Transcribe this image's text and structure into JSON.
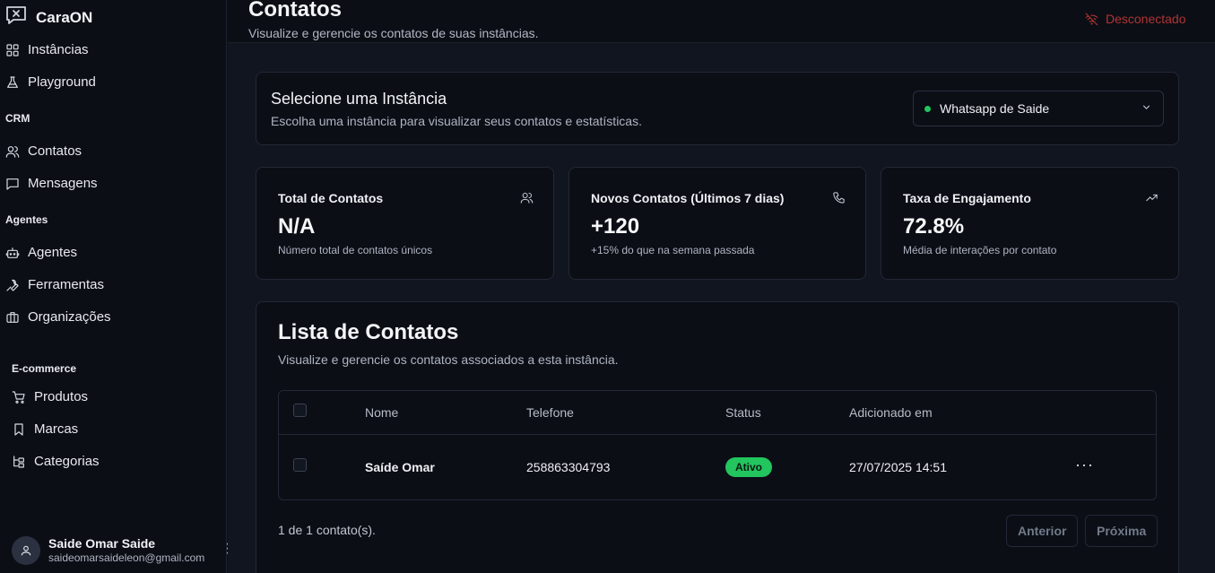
{
  "app": {
    "name": "CaraON"
  },
  "sidebar": {
    "items_top": [
      {
        "label": "Instâncias",
        "icon": "grid-icon"
      },
      {
        "label": "Playground",
        "icon": "flask-icon"
      }
    ],
    "sections": {
      "crm": "CRM",
      "agentes": "Agentes",
      "ecommerce": "E-commerce"
    },
    "crm_items": [
      {
        "label": "Contatos",
        "icon": "users-icon"
      },
      {
        "label": "Mensagens",
        "icon": "message-icon"
      }
    ],
    "agentes_items": [
      {
        "label": "Agentes",
        "icon": "bot-icon"
      },
      {
        "label": "Ferramentas",
        "icon": "wrench-icon"
      },
      {
        "label": "Organizações",
        "icon": "briefcase-icon"
      }
    ],
    "ecommerce_items": [
      {
        "label": "Produtos",
        "icon": "cart-icon"
      },
      {
        "label": "Marcas",
        "icon": "bookmark-icon"
      },
      {
        "label": "Categorias",
        "icon": "hierarchy-icon"
      }
    ],
    "user": {
      "name": "Saide Omar Saide",
      "email": "saideomarsaideleon@gmail.com"
    }
  },
  "header": {
    "title": "Contatos",
    "subtitle": "Visualize e gerencie os contatos de suas instâncias.",
    "status": "Desconectado",
    "status_color": "#b03434"
  },
  "instance": {
    "title": "Selecione uma Instância",
    "subtitle": "Escolha uma instância para visualizar seus contatos e estatísticas.",
    "selected": "Whatsapp de Saide",
    "selected_status_color": "#22c55e"
  },
  "stats": [
    {
      "label": "Total de Contatos",
      "value": "N/A",
      "sub": "Número total de contatos únicos",
      "icon": "users-icon"
    },
    {
      "label": "Novos Contatos (Últimos 7 dias)",
      "value": "+120",
      "sub": "+15% do que na semana passada",
      "icon": "phone-icon"
    },
    {
      "label": "Taxa de Engajamento",
      "value": "72.8%",
      "sub": "Média de interações por contato",
      "icon": "trending-up-icon"
    }
  ],
  "contacts": {
    "title": "Lista de Contatos",
    "subtitle": "Visualize e gerencie os contatos associados a esta instância.",
    "columns": [
      "Nome",
      "Telefone",
      "Status",
      "Adicionado em"
    ],
    "rows": [
      {
        "name": "Saíde Omar",
        "phone": "258863304793",
        "status": "Ativo",
        "added": "27/07/2025 14:51"
      }
    ],
    "count_text": "1 de 1 contato(s).",
    "prev_label": "Anterior",
    "next_label": "Próxima"
  }
}
